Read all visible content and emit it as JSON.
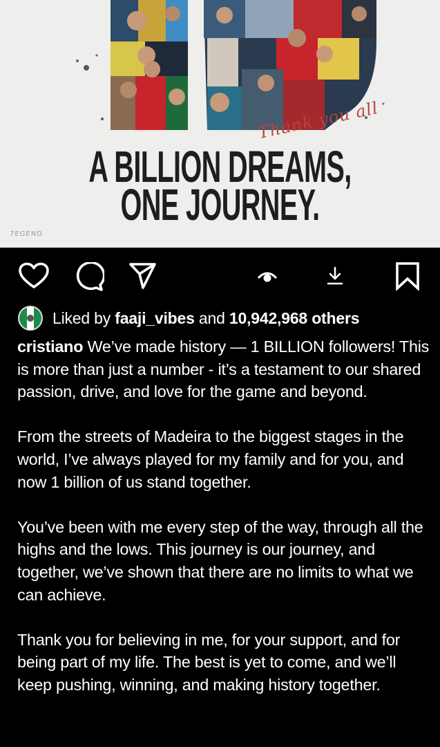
{
  "post_image": {
    "headline_line1": "A BILLION DREAMS,",
    "headline_line2": "ONE JOURNEY.",
    "script_text": "Thank you all",
    "watermark": "7EGEND"
  },
  "actions": {
    "like_icon": "heart-icon",
    "comment_icon": "comment-icon",
    "share_icon": "paper-plane-icon",
    "view_icon": "eye-icon",
    "download_icon": "download-icon",
    "save_icon": "bookmark-icon"
  },
  "likes": {
    "prefix": "Liked by",
    "user": "faaji_vibes",
    "connector": "and",
    "count_text": "10,942,968 others"
  },
  "caption": {
    "username": "cristiano",
    "p1": "We’ve made history — 1 BILLION followers! This is more than just a number - it’s a testament to our shared passion, drive, and love for the game and beyond.",
    "p2": "From the streets of Madeira to the biggest stages in the world, I’ve always played for my family and for you, and now 1 billion of us stand together.",
    "p3": "You’ve been with me every step of the way, through all the highs and the lows. This journey is our journey, and together, we’ve shown that there are no limits to what we can achieve.",
    "p4": "Thank you for believing in me, for your support, and for being part of my life. The best is yet to come, and we’ll keep pushing, winning, and making history together."
  },
  "colors": {
    "background": "#000000",
    "text": "#ffffff",
    "image_bg": "#eeeeec",
    "headline": "#1e1e1e",
    "script": "#b5433f"
  }
}
